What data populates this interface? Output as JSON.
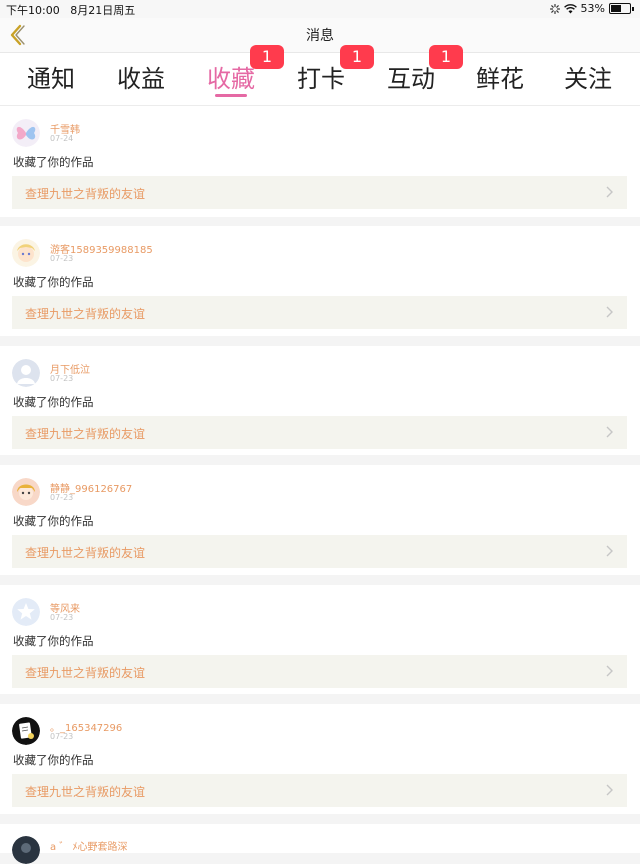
{
  "status_bar": {
    "time": "下午10:00",
    "date": "8月21日周五",
    "battery": "53%",
    "battery_level": 0.53
  },
  "nav": {
    "title": "消息",
    "back_icon": "chevron-left-icon"
  },
  "tabs": [
    {
      "label": "通知",
      "badge": null
    },
    {
      "label": "收益",
      "badge": null
    },
    {
      "label": "收藏",
      "badge": null,
      "active": true
    },
    {
      "label": "打卡",
      "badge": "1"
    },
    {
      "label": "互动",
      "badge": "1"
    },
    {
      "label": "鲜花",
      "badge": null
    },
    {
      "label": "关注",
      "badge": null
    }
  ],
  "tab_badges_floating": {
    "shoucang": "1"
  },
  "notifications": [
    {
      "user": "千雪韩",
      "date": "07-24",
      "action": "收藏了你的作品",
      "work": "查理九世之背叛的友谊",
      "avatar": "butterfly-avatar"
    },
    {
      "user": "游客1589359988185",
      "date": "07-23",
      "action": "收藏了你的作品",
      "work": "查理九世之背叛的友谊",
      "avatar": "girl-avatar"
    },
    {
      "user": "月下低泣",
      "date": "07-23",
      "action": "收藏了你的作品",
      "work": "查理九世之背叛的友谊",
      "avatar": "default-avatar"
    },
    {
      "user": "静静_996126767",
      "date": "07-23",
      "action": "收藏了你的作品",
      "work": "查理九世之背叛的友谊",
      "avatar": "anime-avatar"
    },
    {
      "user": "等风来",
      "date": "07-23",
      "action": "收藏了你的作品",
      "work": "查理九世之背叛的友谊",
      "avatar": "star-avatar"
    },
    {
      "user": "。_165347296",
      "date": "07-23",
      "action": "收藏了你的作品",
      "work": "查理九世之背叛的友谊",
      "avatar": "sketch-avatar"
    },
    {
      "user": "a ゛ ﾒ心野套路深",
      "date": "",
      "action": "",
      "work": "",
      "avatar": "dark-avatar"
    }
  ],
  "colors": {
    "accent": "#e569a4",
    "username": "#e89a64",
    "badge": "#ff3b4d"
  }
}
